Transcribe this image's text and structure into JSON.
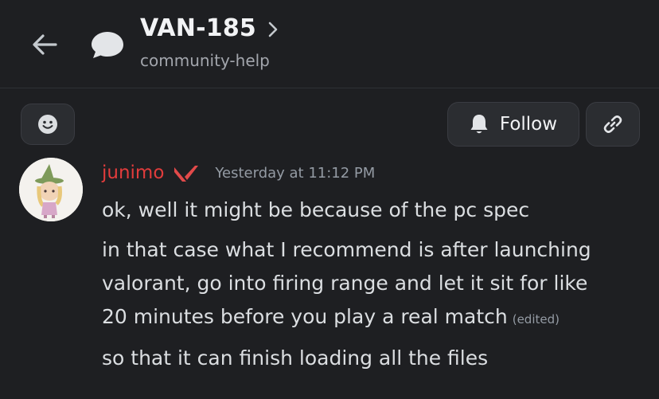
{
  "header": {
    "title": "VAN-185",
    "subtitle": "community-help",
    "back_icon": "arrow-left-icon",
    "thread_icon": "speech-bubble-icon",
    "title_chevron_icon": "chevron-right-icon"
  },
  "toolbar": {
    "emoji_icon": "smiley-icon",
    "follow_label": "Follow",
    "follow_icon": "bell-icon",
    "link_icon": "link-icon"
  },
  "message": {
    "author": "junimo",
    "author_color": "#e23c3c",
    "role_icon": "valorant-logo-icon",
    "timestamp": "Yesterday at 11:12 PM",
    "lines": [
      "ok, well it might be because of the pc spec",
      "in that case what I recommend is after launching",
      "valorant, go into firing range and let it sit for like",
      "20 minutes before you play a real match",
      "so that it can finish loading all the files"
    ],
    "edited_label": "(edited)"
  },
  "colors": {
    "background": "#1e1f22",
    "button_bg": "#2b2d31",
    "text": "#dbdee1",
    "muted": "#949ba4"
  }
}
